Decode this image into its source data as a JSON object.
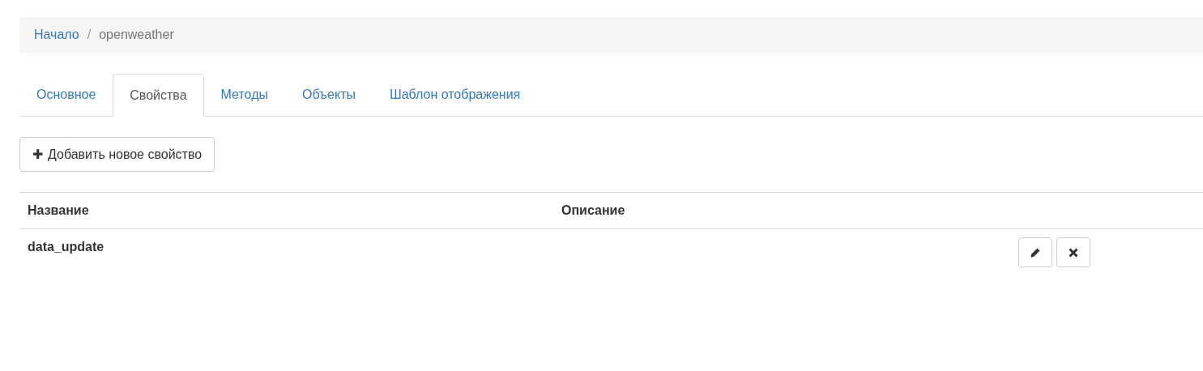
{
  "breadcrumb": {
    "separator": "/",
    "items": [
      {
        "label": "Начало",
        "kind": "link"
      },
      {
        "label": "openweather",
        "kind": "current"
      }
    ]
  },
  "tabs": [
    {
      "label": "Основное",
      "selected": false
    },
    {
      "label": "Свойства",
      "selected": true
    },
    {
      "label": "Методы",
      "selected": false
    },
    {
      "label": "Объекты",
      "selected": false
    },
    {
      "label": "Шаблон отображения",
      "selected": false
    }
  ],
  "add_button": {
    "icon": "✚",
    "label": "Добавить новое свойство"
  },
  "table": {
    "columns": [
      "Название",
      "Описание"
    ],
    "rows": [
      {
        "name": "data_update"
      }
    ]
  }
}
